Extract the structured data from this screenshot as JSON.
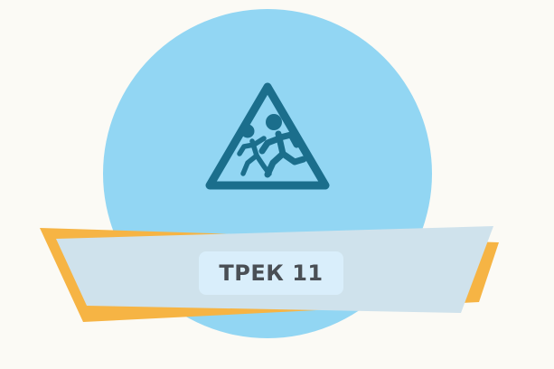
{
  "badge": {
    "label": "ТРЕК 11"
  },
  "icons": {
    "main": "children-crossing-warning-icon"
  },
  "colors": {
    "background": "#fbfaf5",
    "circle": "#92d6f3",
    "ribbon_back": "#f6b444",
    "ribbon_front": "#cfe2ec",
    "badge": "#d9eefb",
    "icon": "#1b6e8c",
    "text": "#4a4f55"
  }
}
